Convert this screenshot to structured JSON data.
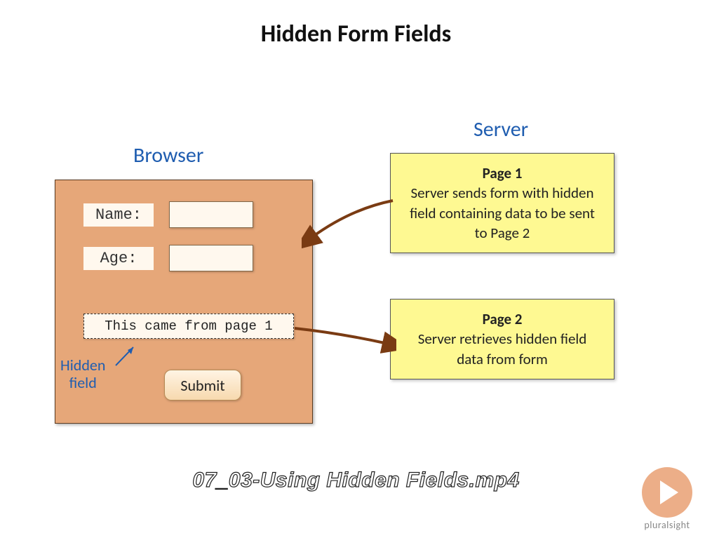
{
  "title": "Hidden Form Fields",
  "labels": {
    "browser": "Browser",
    "server": "Server",
    "hidden_field_annotation": "Hidden\nfield"
  },
  "form": {
    "name_label": "Name:",
    "age_label": "Age:",
    "hidden_value": "This came from page 1",
    "submit_label": "Submit"
  },
  "server_boxes": {
    "page1": {
      "title": "Page 1",
      "desc": "Server sends form with hidden field containing data to be sent to Page 2"
    },
    "page2": {
      "title": "Page 2",
      "desc": "Server retrieves hidden field data from form"
    }
  },
  "filename": "07_03-Using Hidden Fields.mp4",
  "brand": "pluralsight"
}
